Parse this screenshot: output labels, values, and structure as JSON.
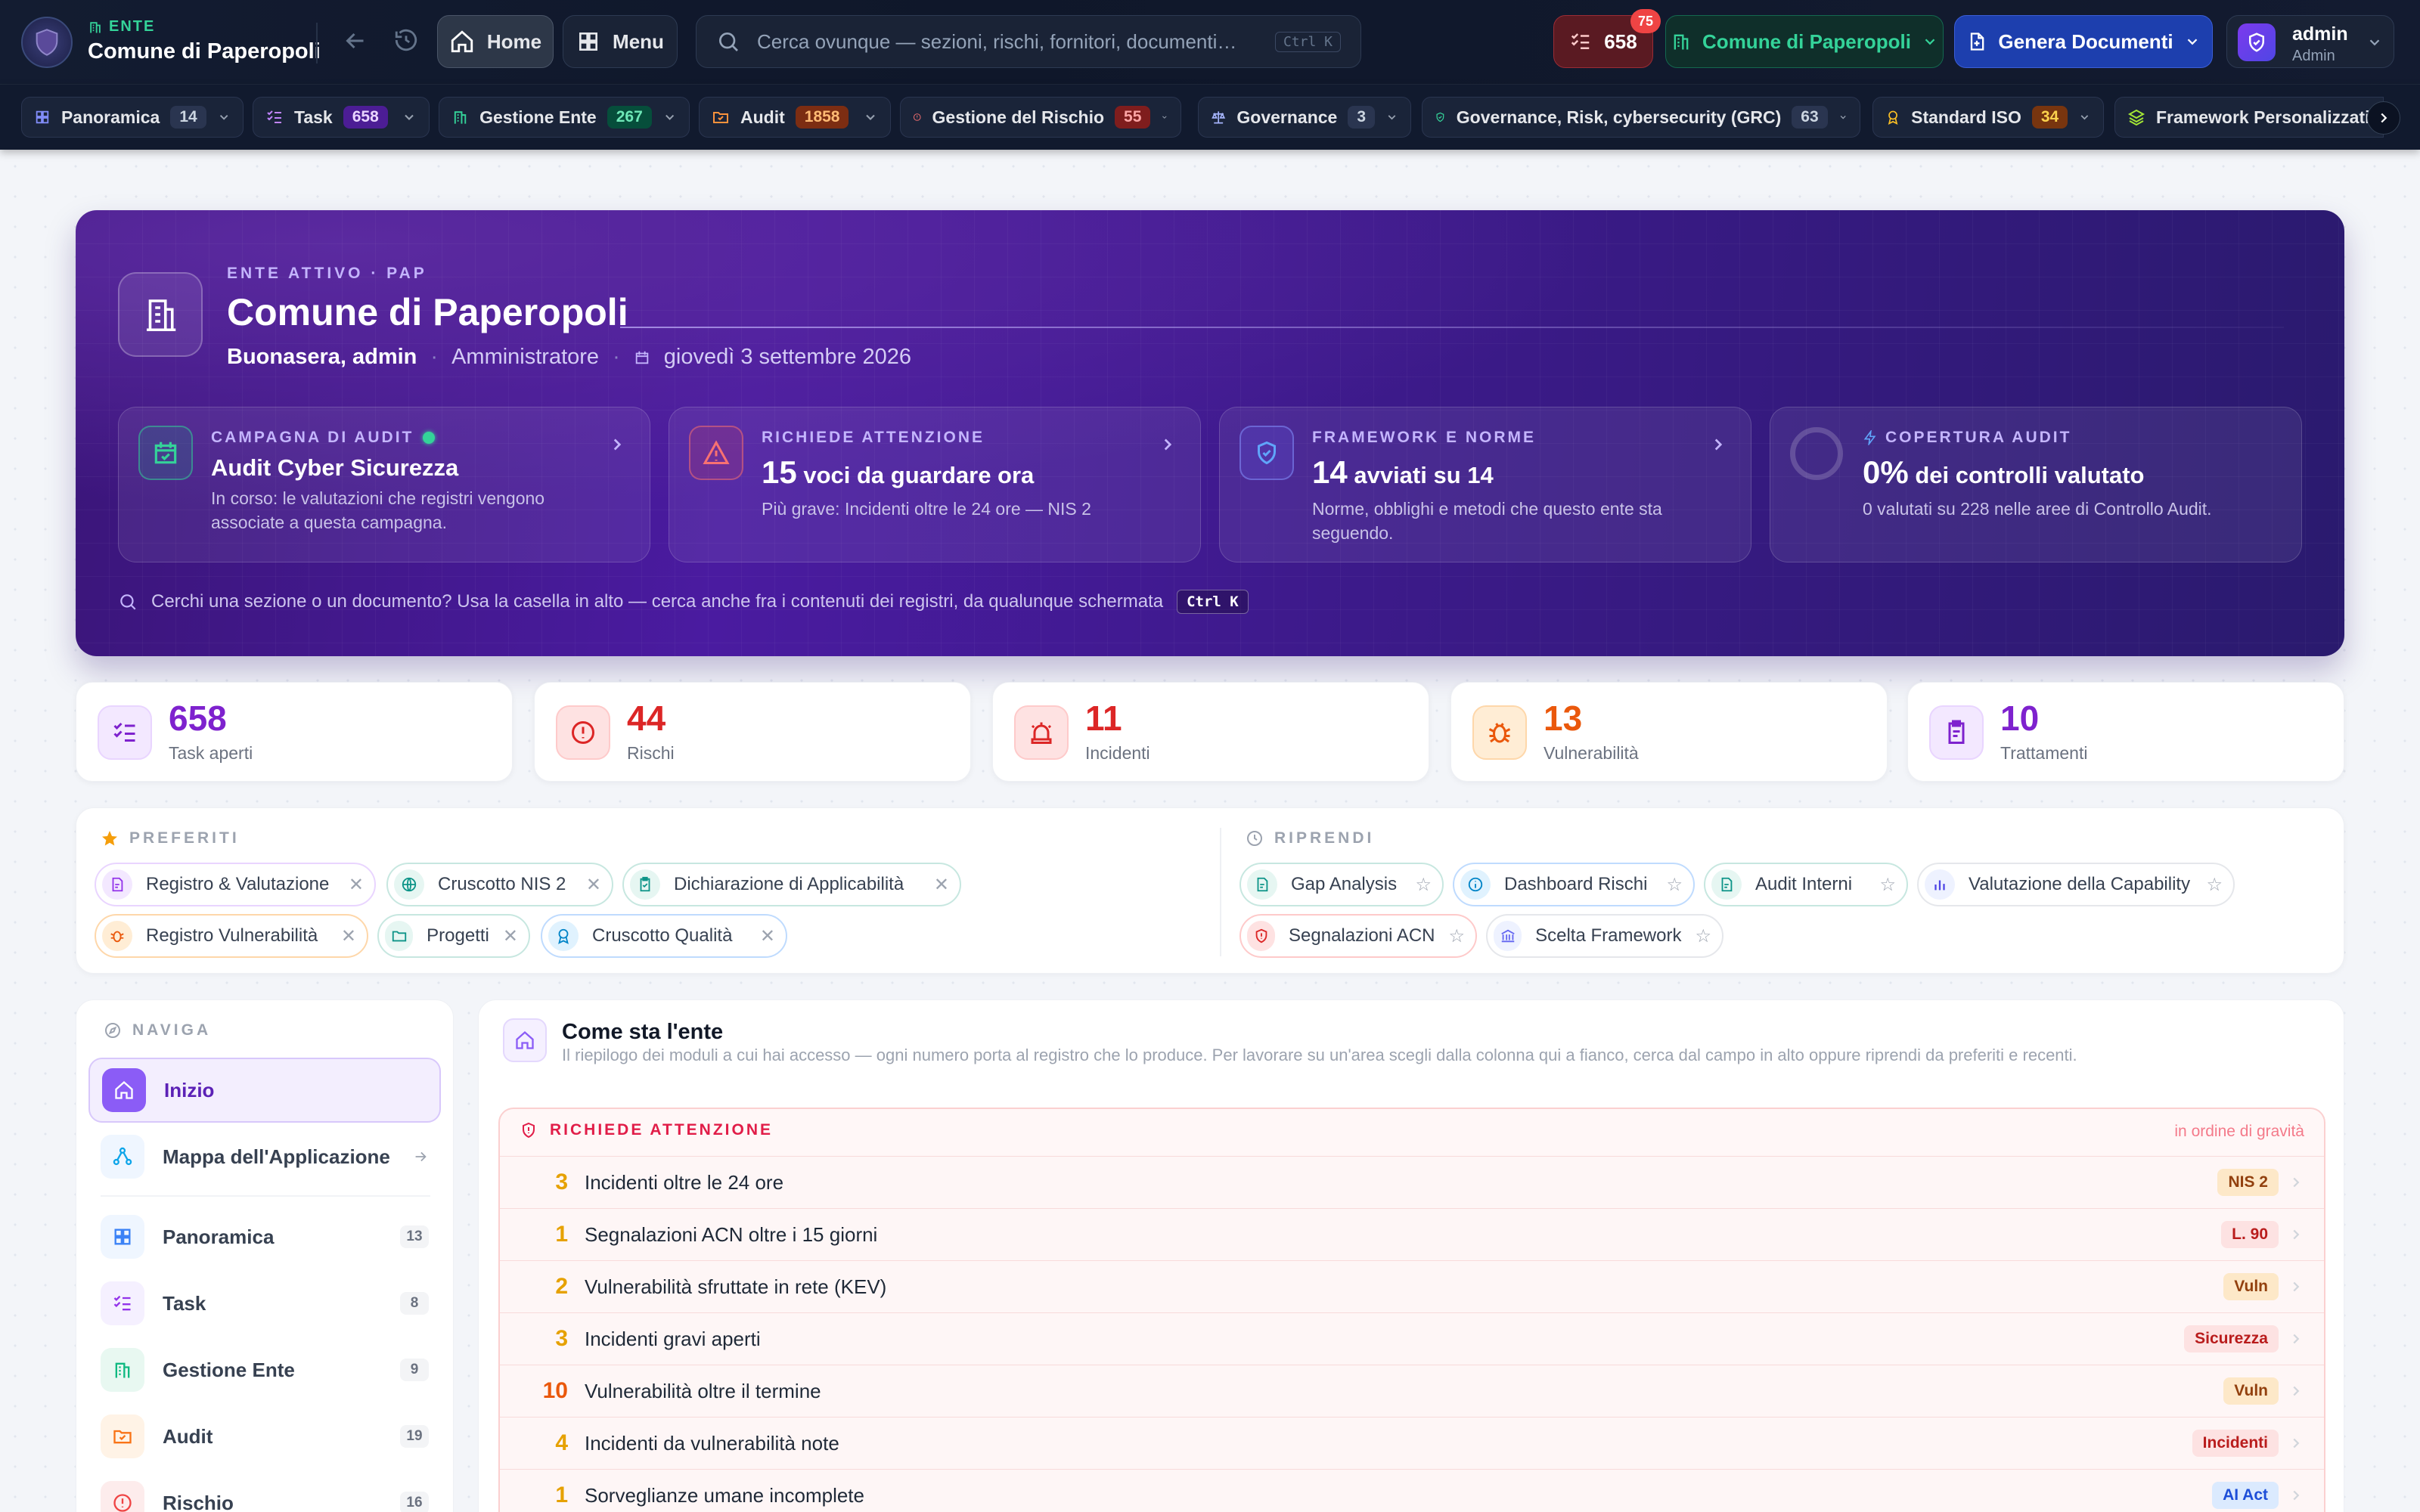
{
  "topbar": {
    "ente_label": "ENTE",
    "ente_name": "Comune di Paperopoli",
    "home_label": "Home",
    "menu_label": "Menu",
    "search_placeholder": "Cerca ovunque — sezioni, rischi, fornitori, documenti…",
    "search_shortcut": "Ctrl K",
    "tasks_count": "658",
    "tasks_badge": "75",
    "entity_selector": "Comune di Paperopoli",
    "generate_docs": "Genera Documenti",
    "user_name": "admin",
    "user_role": "Admin"
  },
  "navbar": {
    "items": [
      {
        "label": "Panoramica",
        "count": "14"
      },
      {
        "label": "Task",
        "count": "658"
      },
      {
        "label": "Gestione Ente",
        "count": "267"
      },
      {
        "label": "Audit",
        "count": "1858"
      },
      {
        "label": "Gestione del Rischio",
        "count": "55"
      },
      {
        "label": "Governance",
        "count": "3"
      },
      {
        "label": "Governance, Risk, cybersecurity (GRC)",
        "count": "63"
      },
      {
        "label": "Standard ISO",
        "count": "34"
      },
      {
        "label": "Framework Personalizzati",
        "count": ""
      }
    ]
  },
  "hero": {
    "eyebrow": "ENTE ATTIVO · PAP",
    "title": "Comune di Paperopoli",
    "greeting": "Buonasera, admin",
    "role": "Amministratore",
    "date": "giovedì 3 settembre 2026",
    "cards": [
      {
        "label": "CAMPAGNA DI AUDIT",
        "title": "Audit Cyber Sicurezza",
        "desc": "In corso: le valutazioni che registri vengono associate a questa campagna."
      },
      {
        "label": "RICHIEDE ATTENZIONE",
        "num": "15",
        "title": "voci da guardare ora",
        "desc": "Più grave: Incidenti oltre le 24 ore — NIS 2"
      },
      {
        "label": "FRAMEWORK E NORME",
        "num": "14",
        "title": "avviati su 14",
        "desc": "Norme, obblighi e metodi che questo ente sta seguendo."
      },
      {
        "label": "COPERTURA AUDIT",
        "num": "0%",
        "title": "dei controlli valutato",
        "desc": "0 valutati su 228 nelle aree di Controllo Audit.",
        "progress": 0
      }
    ],
    "hint": "Cerchi una sezione o un documento? Usa la casella in alto — cerca anche fra i contenuti dei registri, da qualunque schermata",
    "hint_shortcut": "Ctrl K"
  },
  "stats": [
    {
      "value": "658",
      "label": "Task aperti",
      "color": "#7e22ce"
    },
    {
      "value": "44",
      "label": "Rischi",
      "color": "#dc2626"
    },
    {
      "value": "11",
      "label": "Incidenti",
      "color": "#dc2626"
    },
    {
      "value": "13",
      "label": "Vulnerabilità",
      "color": "#ea580c"
    },
    {
      "value": "10",
      "label": "Trattamenti",
      "color": "#7e22ce"
    }
  ],
  "favorites": {
    "title": "PREFERITI",
    "items": [
      "Registro & Valutazione",
      "Cruscotto NIS 2",
      "Dichiarazione di Applicabilità",
      "Registro Vulnerabilità",
      "Progetti",
      "Cruscotto Qualità"
    ]
  },
  "resume": {
    "title": "RIPRENDI",
    "items": [
      "Gap Analysis",
      "Dashboard Rischi",
      "Audit Interni",
      "Valutazione della Capability",
      "Segnalazioni ACN",
      "Scelta Framework"
    ]
  },
  "sidebar": {
    "title": "NAVIGA",
    "items": [
      {
        "label": "Inizio",
        "count": ""
      },
      {
        "label": "Mappa dell'Applicazione",
        "count": ""
      },
      {
        "label": "Panoramica",
        "count": "13"
      },
      {
        "label": "Task",
        "count": "8"
      },
      {
        "label": "Gestione Ente",
        "count": "9"
      },
      {
        "label": "Audit",
        "count": "19"
      },
      {
        "label": "Rischio",
        "count": "16"
      }
    ]
  },
  "main": {
    "title": "Come sta l'ente",
    "subtitle": "Il riepilogo dei moduli a cui hai accesso — ogni numero porta al registro che lo produce. Per lavorare su un'area scegli dalla colonna qui a fianco, cerca dal campo in alto oppure riprendi da preferiti e recenti.",
    "attention": {
      "title": "RICHIEDE ATTENZIONE",
      "order": "in ordine di gravità",
      "rows": [
        {
          "n": "3",
          "text": "Incidenti oltre le 24 ore",
          "tag": "NIS 2"
        },
        {
          "n": "1",
          "text": "Segnalazioni ACN oltre i 15 giorni",
          "tag": "L. 90"
        },
        {
          "n": "2",
          "text": "Vulnerabilità sfruttate in rete (KEV)",
          "tag": "Vuln"
        },
        {
          "n": "3",
          "text": "Incidenti gravi aperti",
          "tag": "Sicurezza"
        },
        {
          "n": "10",
          "text": "Vulnerabilità oltre il termine",
          "tag": "Vuln"
        },
        {
          "n": "4",
          "text": "Incidenti da vulnerabilità note",
          "tag": "Incidenti"
        },
        {
          "n": "1",
          "text": "Sorveglianze umane incomplete",
          "tag": "AI Act"
        }
      ]
    }
  }
}
